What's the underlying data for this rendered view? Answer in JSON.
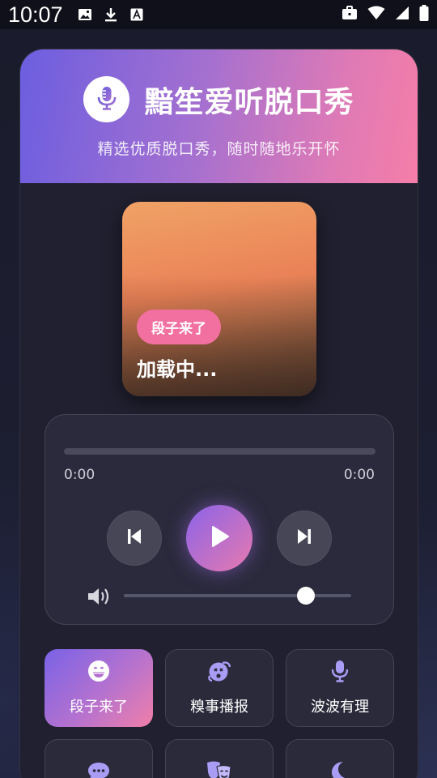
{
  "status_bar": {
    "time": "10:07",
    "icons": [
      "image-icon",
      "download-icon",
      "font-icon",
      "briefcase-icon",
      "wifi-icon",
      "signal-icon",
      "battery-icon"
    ]
  },
  "app": {
    "title": "黯笙爱听脱口秀",
    "subtitle": "精选优质脱口秀，随时随地乐开怀"
  },
  "now_playing": {
    "tag": "段子来了",
    "title": "加载中..."
  },
  "player": {
    "current_time": "0:00",
    "duration": "0:00",
    "progress": 0,
    "volume": 0.8
  },
  "categories": [
    {
      "label": "段子来了",
      "icon": "grin-icon",
      "active": true
    },
    {
      "label": "糗事播报",
      "icon": "dizzy-face-icon",
      "active": false
    },
    {
      "label": "波波有理",
      "icon": "microphone-icon",
      "active": false
    },
    {
      "label": "",
      "icon": "chat-bubble-icon",
      "active": false
    },
    {
      "label": "",
      "icon": "theater-masks-icon",
      "active": false
    },
    {
      "label": "",
      "icon": "moon-icon",
      "active": false
    }
  ],
  "colors": {
    "accent_start": "#6c5ee0",
    "accent_end": "#f57ea8",
    "tag": "#f2709f",
    "icon_purple": "#a99cf5"
  }
}
